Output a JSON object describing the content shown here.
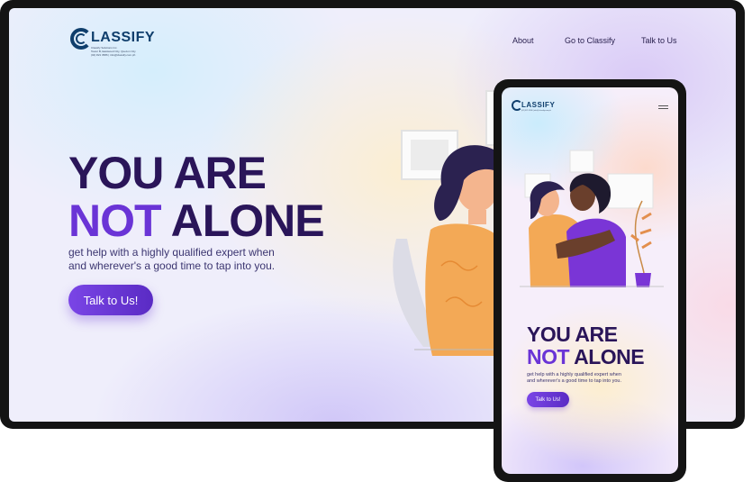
{
  "brand": {
    "name": "LASSIFY",
    "initial": "C",
    "tagline_1": "Classify Solutions Inc.",
    "tagline_2": "Tower B, Eastwood City, Quezon City",
    "tagline_3": "(02) 821 3586 | info@classify.com.ph"
  },
  "nav": {
    "about": "About",
    "go_to_classify": "Go to Classify",
    "talk_to_us": "Talk to Us"
  },
  "hero": {
    "line1": "YOU ARE",
    "line2_highlight": "NOT",
    "line2_rest": " ALONE",
    "subtitle_1": "get help with a highly qualified expert when",
    "subtitle_2": "and wherever's a good time to tap into you.",
    "cta_label": "Talk to Us!"
  },
  "colors": {
    "title": "#2a1559",
    "accent": "#6a34d6",
    "logo": "#0f3e6c",
    "frame": "#141414"
  },
  "icons": [
    "menu-icon",
    "illustration-hug"
  ]
}
